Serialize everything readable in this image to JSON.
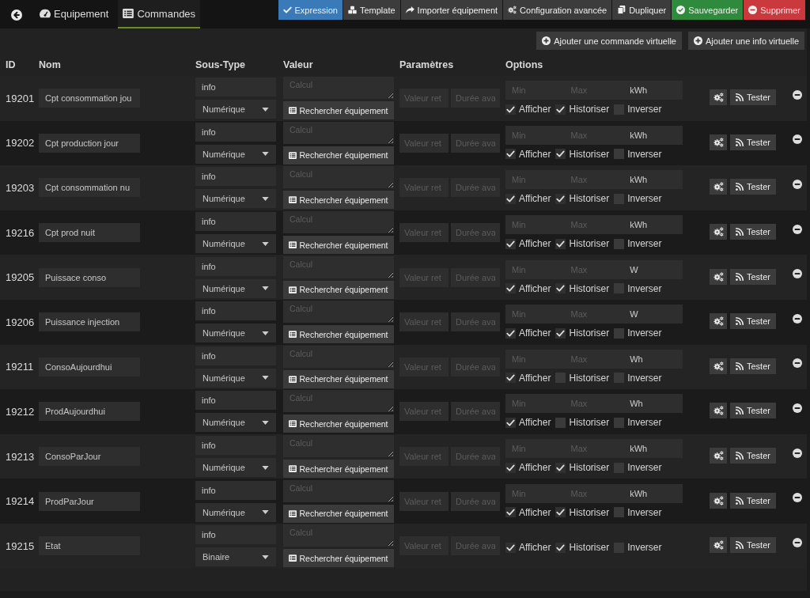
{
  "tabs": [
    {
      "label": "Equipement",
      "selected": false
    },
    {
      "label": "Commandes",
      "selected": true
    }
  ],
  "actions": [
    {
      "label": "Expression",
      "kind": "primary"
    },
    {
      "label": "Template",
      "kind": "default"
    },
    {
      "label": "Importer équipement",
      "kind": "default"
    },
    {
      "label": "Configuration avancée",
      "kind": "default"
    },
    {
      "label": "Dupliquer",
      "kind": "default"
    },
    {
      "label": "Sauvegarder",
      "kind": "success"
    },
    {
      "label": "Supprimer",
      "kind": "danger"
    }
  ],
  "add_buttons": [
    "Ajouter une commande virtuelle",
    "Ajouter une info virtuelle"
  ],
  "table": {
    "columns": [
      "ID",
      "Nom",
      "Sous-Type",
      "Valeur",
      "Paramètres",
      "Options"
    ],
    "rows": [
      {
        "id": "19201",
        "name": "Cpt consommation jou",
        "type": "info",
        "subtype": "Numérique",
        "value_placeholder": "Calcul",
        "search_button": "Rechercher équipement",
        "params": [
          {
            "placeholder": "Valeur ret"
          },
          {
            "placeholder": "Durée ava"
          }
        ],
        "limits": {
          "min_placeholder": "Min",
          "max_placeholder": "Max",
          "unit": "kWh"
        },
        "options": [
          {
            "label": "Afficher",
            "checked": true
          },
          {
            "label": "Historiser",
            "checked": true
          },
          {
            "label": "Inverser",
            "checked": false
          }
        ],
        "test_button": "Tester"
      },
      {
        "id": "19202",
        "name": "Cpt production jour",
        "type": "info",
        "subtype": "Numérique",
        "value_placeholder": "Calcul",
        "search_button": "Rechercher équipement",
        "params": [
          {
            "placeholder": "Valeur ret"
          },
          {
            "placeholder": "Durée ava"
          }
        ],
        "limits": {
          "min_placeholder": "Min",
          "max_placeholder": "Max",
          "unit": "kWh"
        },
        "options": [
          {
            "label": "Afficher",
            "checked": true
          },
          {
            "label": "Historiser",
            "checked": true
          },
          {
            "label": "Inverser",
            "checked": false
          }
        ],
        "test_button": "Tester"
      },
      {
        "id": "19203",
        "name": "Cpt consommation nu",
        "type": "info",
        "subtype": "Numérique",
        "value_placeholder": "Calcul",
        "search_button": "Rechercher équipement",
        "params": [
          {
            "placeholder": "Valeur ret"
          },
          {
            "placeholder": "Durée ava"
          }
        ],
        "limits": {
          "min_placeholder": "Min",
          "max_placeholder": "Max",
          "unit": "kWh"
        },
        "options": [
          {
            "label": "Afficher",
            "checked": true
          },
          {
            "label": "Historiser",
            "checked": true
          },
          {
            "label": "Inverser",
            "checked": false
          }
        ],
        "test_button": "Tester"
      },
      {
        "id": "19216",
        "name": "Cpt prod nuit",
        "type": "info",
        "subtype": "Numérique",
        "value_placeholder": "Calcul",
        "search_button": "Rechercher équipement",
        "params": [
          {
            "placeholder": "Valeur ret"
          },
          {
            "placeholder": "Durée ava"
          }
        ],
        "limits": {
          "min_placeholder": "Min",
          "max_placeholder": "Max",
          "unit": "kWh"
        },
        "options": [
          {
            "label": "Afficher",
            "checked": true
          },
          {
            "label": "Historiser",
            "checked": true
          },
          {
            "label": "Inverser",
            "checked": false
          }
        ],
        "test_button": "Tester"
      },
      {
        "id": "19205",
        "name": "Puissace conso",
        "type": "info",
        "subtype": "Numérique",
        "value_placeholder": "Calcul",
        "search_button": "Rechercher équipement",
        "params": [
          {
            "placeholder": "Valeur ret"
          },
          {
            "placeholder": "Durée ava"
          }
        ],
        "limits": {
          "min_placeholder": "Min",
          "max_placeholder": "Max",
          "unit": "W"
        },
        "options": [
          {
            "label": "Afficher",
            "checked": true
          },
          {
            "label": "Historiser",
            "checked": true
          },
          {
            "label": "Inverser",
            "checked": false
          }
        ],
        "test_button": "Tester"
      },
      {
        "id": "19206",
        "name": "Puissance injection",
        "type": "info",
        "subtype": "Numérique",
        "value_placeholder": "Calcul",
        "search_button": "Rechercher équipement",
        "params": [
          {
            "placeholder": "Valeur ret"
          },
          {
            "placeholder": "Durée ava"
          }
        ],
        "limits": {
          "min_placeholder": "Min",
          "max_placeholder": "Max",
          "unit": "W"
        },
        "options": [
          {
            "label": "Afficher",
            "checked": true
          },
          {
            "label": "Historiser",
            "checked": true
          },
          {
            "label": "Inverser",
            "checked": false
          }
        ],
        "test_button": "Tester"
      },
      {
        "id": "19211",
        "name": "ConsoAujourdhui",
        "type": "info",
        "subtype": "Numérique",
        "value_placeholder": "Calcul",
        "search_button": "Rechercher équipement",
        "params": [
          {
            "placeholder": "Valeur ret"
          },
          {
            "placeholder": "Durée ava"
          }
        ],
        "limits": {
          "min_placeholder": "Min",
          "max_placeholder": "Max",
          "unit": "Wh"
        },
        "options": [
          {
            "label": "Afficher",
            "checked": true
          },
          {
            "label": "Historiser",
            "checked": false
          },
          {
            "label": "Inverser",
            "checked": false
          }
        ],
        "test_button": "Tester"
      },
      {
        "id": "19212",
        "name": "ProdAujourdhui",
        "type": "info",
        "subtype": "Numérique",
        "value_placeholder": "Calcul",
        "search_button": "Rechercher équipement",
        "params": [
          {
            "placeholder": "Valeur ret"
          },
          {
            "placeholder": "Durée ava"
          }
        ],
        "limits": {
          "min_placeholder": "Min",
          "max_placeholder": "Max",
          "unit": "Wh"
        },
        "options": [
          {
            "label": "Afficher",
            "checked": true
          },
          {
            "label": "Historiser",
            "checked": false
          },
          {
            "label": "Inverser",
            "checked": false
          }
        ],
        "test_button": "Tester"
      },
      {
        "id": "19213",
        "name": "ConsoParJour",
        "type": "info",
        "subtype": "Numérique",
        "value_placeholder": "Calcul",
        "search_button": "Rechercher équipement",
        "params": [
          {
            "placeholder": "Valeur ret"
          },
          {
            "placeholder": "Durée ava"
          }
        ],
        "limits": {
          "min_placeholder": "Min",
          "max_placeholder": "Max",
          "unit": "kWh"
        },
        "options": [
          {
            "label": "Afficher",
            "checked": true
          },
          {
            "label": "Historiser",
            "checked": true
          },
          {
            "label": "Inverser",
            "checked": false
          }
        ],
        "test_button": "Tester"
      },
      {
        "id": "19214",
        "name": "ProdParJour",
        "type": "info",
        "subtype": "Numérique",
        "value_placeholder": "Calcul",
        "search_button": "Rechercher équipement",
        "params": [
          {
            "placeholder": "Valeur ret"
          },
          {
            "placeholder": "Durée ava"
          }
        ],
        "limits": {
          "min_placeholder": "Min",
          "max_placeholder": "Max",
          "unit": "kWh"
        },
        "options": [
          {
            "label": "Afficher",
            "checked": true
          },
          {
            "label": "Historiser",
            "checked": true
          },
          {
            "label": "Inverser",
            "checked": false
          }
        ],
        "test_button": "Tester"
      },
      {
        "id": "19215",
        "name": "Etat",
        "type": "info",
        "subtype": "Binaire",
        "value_placeholder": "Calcul",
        "search_button": "Rechercher équipement",
        "params": [
          {
            "placeholder": "Valeur ret"
          },
          {
            "placeholder": "Durée ava"
          }
        ],
        "options": [
          {
            "label": "Afficher",
            "checked": true
          },
          {
            "label": "Historiser",
            "checked": true
          },
          {
            "label": "Inverser",
            "checked": false
          }
        ],
        "test_button": "Tester"
      }
    ]
  }
}
